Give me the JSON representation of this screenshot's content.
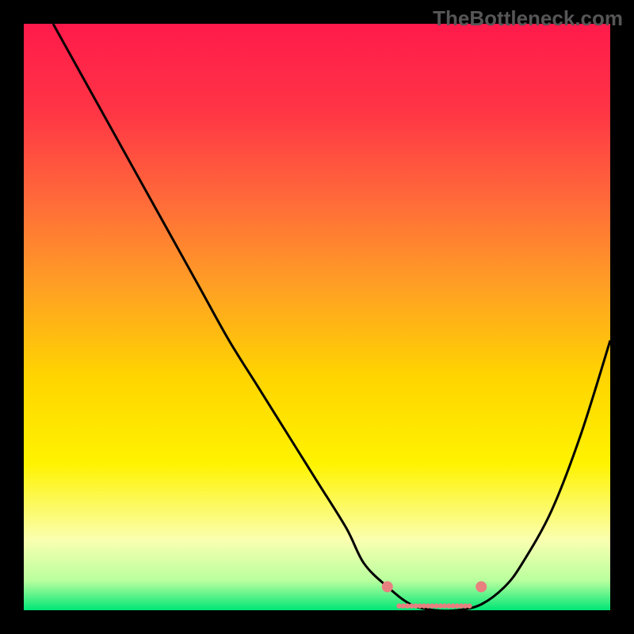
{
  "watermark": "TheBottleneck.com",
  "chart_data": {
    "type": "line",
    "title": "",
    "xlabel": "",
    "ylabel": "",
    "xlim": [
      0,
      100
    ],
    "ylim": [
      0,
      100
    ],
    "grid": false,
    "legend": false,
    "background": {
      "type": "vertical-gradient",
      "stops": [
        {
          "pos": 0.0,
          "color": "#ff1a4b"
        },
        {
          "pos": 0.15,
          "color": "#ff3545"
        },
        {
          "pos": 0.3,
          "color": "#ff6a3a"
        },
        {
          "pos": 0.45,
          "color": "#ffa024"
        },
        {
          "pos": 0.6,
          "color": "#ffd400"
        },
        {
          "pos": 0.75,
          "color": "#fff300"
        },
        {
          "pos": 0.88,
          "color": "#faffb0"
        },
        {
          "pos": 0.95,
          "color": "#b8ff9e"
        },
        {
          "pos": 1.0,
          "color": "#00e676"
        }
      ]
    },
    "series": [
      {
        "name": "bottleneck-curve",
        "color": "#000000",
        "x": [
          5,
          10,
          15,
          20,
          25,
          30,
          35,
          40,
          45,
          50,
          55,
          58,
          62,
          66,
          70,
          74,
          78,
          82,
          85,
          90,
          95,
          100
        ],
        "y": [
          100,
          91,
          82,
          73,
          64,
          55,
          46,
          38,
          30,
          22,
          14,
          8,
          4,
          1,
          0,
          0,
          1,
          4,
          8,
          17,
          30,
          46
        ]
      },
      {
        "name": "optimal-range-marker",
        "color": "#e88080",
        "style": "dotted-band",
        "x": [
          62,
          64,
          66,
          68,
          70,
          72,
          74,
          76,
          78
        ],
        "y": [
          4,
          2.5,
          1.5,
          1,
          1,
          1,
          1.5,
          2.5,
          4
        ]
      }
    ],
    "annotations": []
  },
  "frame": {
    "outer_color": "#000000",
    "inner_left": 30,
    "inner_top": 30,
    "inner_width": 740,
    "inner_height": 740
  }
}
